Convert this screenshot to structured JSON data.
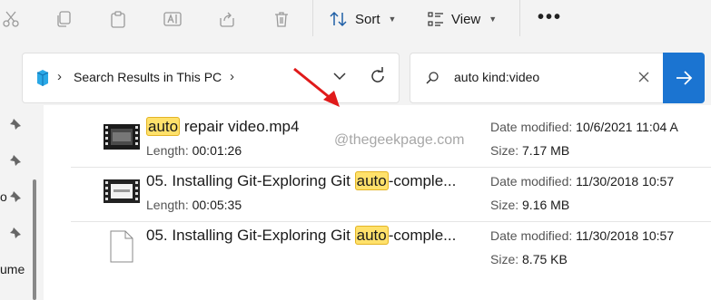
{
  "toolbar": {
    "sort_label": "Sort",
    "view_label": "View",
    "more_label": "•••"
  },
  "address": {
    "path": "Search Results in This PC"
  },
  "search": {
    "query": "auto kind:video"
  },
  "nav": {
    "partial_label_1": "o",
    "partial_label_2": "ume"
  },
  "watermark": "@thegeekpage.com",
  "results": [
    {
      "name_highlight": "auto",
      "name_rest": " repair video.mp4",
      "length_label": "Length:",
      "length": "00:01:26",
      "date_label": "Date modified:",
      "date": "10/6/2021 11:04 A",
      "size_label": "Size:",
      "size": "7.17 MB"
    },
    {
      "name_before": "05. Installing Git-Exploring Git ",
      "name_highlight": "auto",
      "name_after": "-comple...",
      "length_label": "Length:",
      "length": "00:05:35",
      "date_label": "Date modified:",
      "date": "11/30/2018 10:57",
      "size_label": "Size:",
      "size": "9.16 MB"
    },
    {
      "name_before": "05. Installing Git-Exploring Git ",
      "name_highlight": "auto",
      "name_after": "-comple...",
      "date_label": "Date modified:",
      "date": "11/30/2018 10:57",
      "size_label": "Size:",
      "size": "8.75 KB"
    }
  ]
}
